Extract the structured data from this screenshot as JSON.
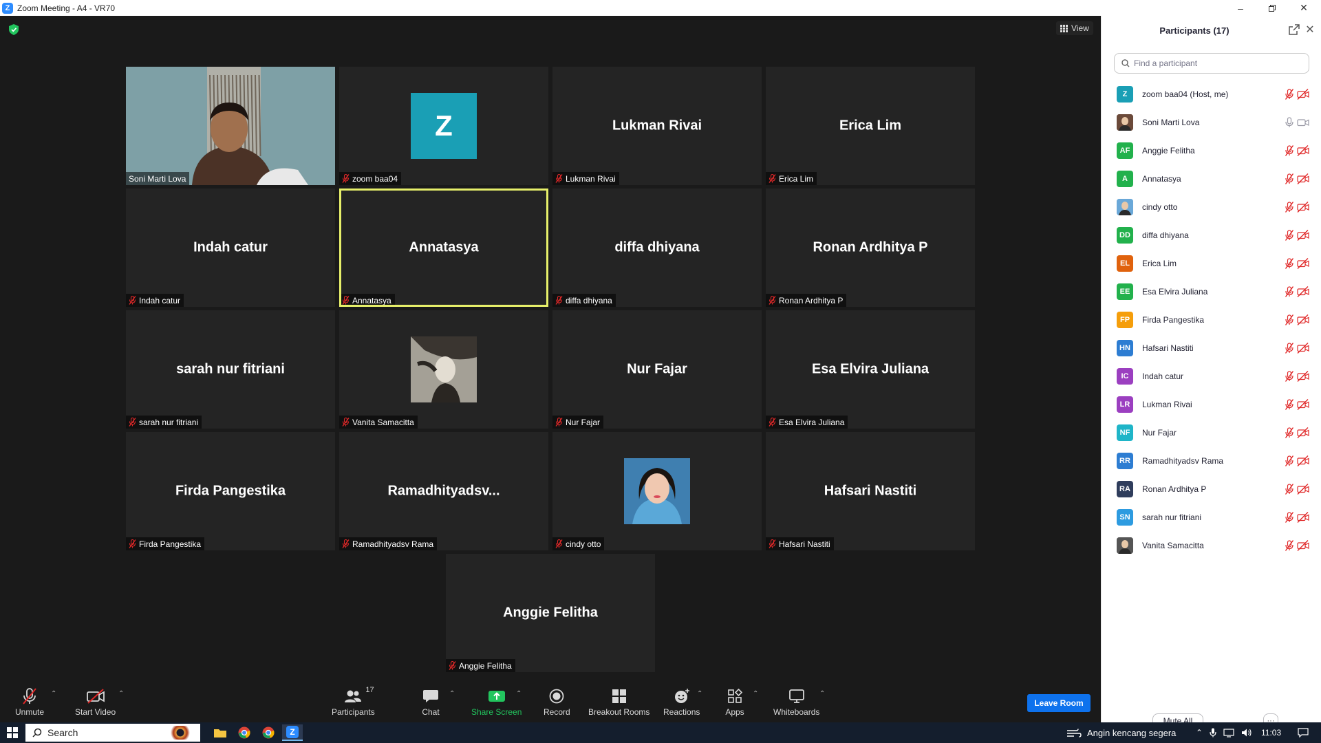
{
  "window": {
    "title": "Zoom Meeting - A4 - VR70"
  },
  "view_button": {
    "label": "View"
  },
  "tiles": [
    {
      "name": "Soni Marti Lova",
      "label": "Soni Marti Lova",
      "kind": "video"
    },
    {
      "name": "zoom baa04",
      "label": "zoom baa04",
      "kind": "avatar",
      "initial": "Z"
    },
    {
      "name": "Lukman Rivai",
      "label": "Lukman Rivai",
      "kind": "name"
    },
    {
      "name": "Erica Lim",
      "label": "Erica Lim",
      "kind": "name"
    },
    {
      "name": "Indah catur",
      "label": "Indah catur",
      "kind": "name"
    },
    {
      "name": "Annatasya",
      "label": "Annatasya",
      "kind": "name",
      "active": true
    },
    {
      "name": "diffa dhiyana",
      "label": "diffa dhiyana",
      "kind": "name"
    },
    {
      "name": "Ronan Ardhitya P",
      "label": "Ronan Ardhitya P",
      "kind": "name"
    },
    {
      "name": "sarah nur fitriani",
      "label": "sarah nur fitriani",
      "kind": "name"
    },
    {
      "name": "Vanita Samacitta",
      "label": "Vanita Samacitta",
      "kind": "photo"
    },
    {
      "name": "Nur Fajar",
      "label": "Nur Fajar",
      "kind": "name"
    },
    {
      "name": "Esa Elvira Juliana",
      "label": "Esa Elvira Juliana",
      "kind": "name"
    },
    {
      "name": "Firda Pangestika",
      "label": "Firda Pangestika",
      "kind": "name"
    },
    {
      "name": "Ramadhityadsv...",
      "label": "Ramadhityadsv Rama",
      "kind": "name"
    },
    {
      "name": "cindy otto",
      "label": "cindy otto",
      "kind": "photo"
    },
    {
      "name": "Hafsari Nastiti",
      "label": "Hafsari Nastiti",
      "kind": "name"
    },
    {
      "name": "Anggie Felitha",
      "label": "Anggie Felitha",
      "kind": "name"
    }
  ],
  "toolbar": {
    "unmute": "Unmute",
    "start_video": "Start Video",
    "participants": "Participants",
    "participants_count": "17",
    "chat": "Chat",
    "share_screen": "Share Screen",
    "record": "Record",
    "breakout_rooms": "Breakout Rooms",
    "reactions": "Reactions",
    "apps": "Apps",
    "whiteboards": "Whiteboards",
    "leave_room": "Leave Room"
  },
  "participants_panel": {
    "title": "Participants (17)",
    "search_placeholder": "Find a participant",
    "mute_all": "Mute All",
    "more": "···",
    "list": [
      {
        "initials": "Z",
        "name": "zoom baa04 (Host, me)",
        "color": "#1a9fb5",
        "muted": true
      },
      {
        "initials": "",
        "name": "Soni Marti Lova",
        "color": "#6b4a3a",
        "muted": false,
        "photo": true
      },
      {
        "initials": "AF",
        "name": "Anggie Felitha",
        "color": "#22b14c",
        "muted": true
      },
      {
        "initials": "A",
        "name": "Annatasya",
        "color": "#22b14c",
        "muted": true
      },
      {
        "initials": "",
        "name": "cindy otto",
        "color": "#6aa8d8",
        "muted": true,
        "photo": true
      },
      {
        "initials": "DD",
        "name": "diffa dhiyana",
        "color": "#22b14c",
        "muted": true
      },
      {
        "initials": "EL",
        "name": "Erica Lim",
        "color": "#e0620d",
        "muted": true
      },
      {
        "initials": "EE",
        "name": "Esa Elvira Juliana",
        "color": "#22b14c",
        "muted": true
      },
      {
        "initials": "FP",
        "name": "Firda Pangestika",
        "color": "#f59e0b",
        "muted": true
      },
      {
        "initials": "HN",
        "name": "Hafsari Nastiti",
        "color": "#2d7dd2",
        "muted": true
      },
      {
        "initials": "IC",
        "name": "Indah catur",
        "color": "#9b3fc0",
        "muted": true
      },
      {
        "initials": "LR",
        "name": "Lukman Rivai",
        "color": "#9b3fc0",
        "muted": true
      },
      {
        "initials": "NF",
        "name": "Nur Fajar",
        "color": "#1fb5c8",
        "muted": true
      },
      {
        "initials": "RR",
        "name": "Ramadhityadsv Rama",
        "color": "#2d7dd2",
        "muted": true
      },
      {
        "initials": "RA",
        "name": "Ronan Ardhitya P",
        "color": "#2f3d5c",
        "muted": true
      },
      {
        "initials": "SN",
        "name": "sarah nur fitriani",
        "color": "#2d9be0",
        "muted": true
      },
      {
        "initials": "",
        "name": "Vanita Samacitta",
        "color": "#555555",
        "muted": true,
        "photo": true
      }
    ]
  },
  "taskbar": {
    "search": "Search",
    "weather": "Angin kencang segera",
    "time": "11:03"
  },
  "colors": {
    "accent": "#0e72ed",
    "active_speaker": "#e7f06a",
    "muted_red": "#e02828",
    "share_green": "#22c55e"
  }
}
